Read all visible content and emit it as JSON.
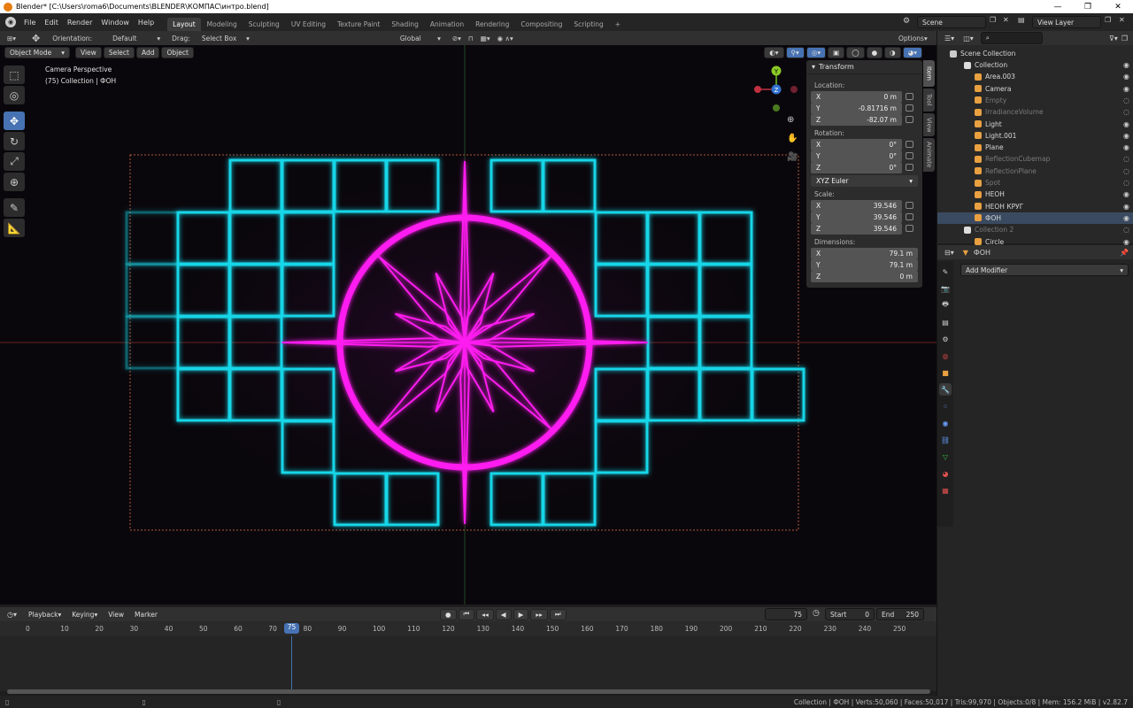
{
  "window": {
    "title": "Blender* [C:\\Users\\roma6\\Documents\\BLENDER\\КОМПАС\\интро.blend]",
    "min": "—",
    "max": "❐",
    "close": "✕"
  },
  "menu": [
    "File",
    "Edit",
    "Render",
    "Window",
    "Help"
  ],
  "workspaces": [
    "Layout",
    "Modeling",
    "Sculpting",
    "UV Editing",
    "Texture Paint",
    "Shading",
    "Animation",
    "Rendering",
    "Compositing",
    "Scripting",
    "+"
  ],
  "scene": {
    "name": "Scene",
    "view_layer": "View Layer"
  },
  "toolheader": {
    "orientation_label": "Orientation:",
    "orientation_value": "Default",
    "drag_label": "Drag:",
    "drag_value": "Select Box",
    "transform_orient": "Global",
    "options": "Options"
  },
  "viewport_header": {
    "mode": "Object Mode",
    "view": "View",
    "select": "Select",
    "add": "Add",
    "object": "Object"
  },
  "viewport": {
    "camera_label": "Camera Perspective",
    "collection_label": "(75) Collection | ФОН",
    "neon_pink": "#ff1cf0",
    "neon_cyan": "#19d6e8",
    "background": "#0a070c"
  },
  "gizmo": {
    "y": "Y",
    "z": "Z"
  },
  "npanel": {
    "title": "Transform",
    "location_label": "Location:",
    "location": [
      {
        "axis": "X",
        "value": "0 m"
      },
      {
        "axis": "Y",
        "value": "-0.81716 m"
      },
      {
        "axis": "Z",
        "value": "-82.07 m"
      }
    ],
    "rotation_label": "Rotation:",
    "rotation": [
      {
        "axis": "X",
        "value": "0°"
      },
      {
        "axis": "Y",
        "value": "0°"
      },
      {
        "axis": "Z",
        "value": "0°"
      }
    ],
    "rotation_mode": "XYZ Euler",
    "scale_label": "Scale:",
    "scale": [
      {
        "axis": "X",
        "value": "39.546"
      },
      {
        "axis": "Y",
        "value": "39.546"
      },
      {
        "axis": "Z",
        "value": "39.546"
      }
    ],
    "dimensions_label": "Dimensions:",
    "dimensions": [
      {
        "axis": "X",
        "value": "79.1 m"
      },
      {
        "axis": "Y",
        "value": "79.1 m"
      },
      {
        "axis": "Z",
        "value": "0 m"
      }
    ],
    "tabs": [
      "Item",
      "Tool",
      "View",
      "Animate"
    ]
  },
  "timeline": {
    "playback": "Playback",
    "keying": "Keying",
    "view": "View",
    "marker": "Marker",
    "current_frame": "75",
    "start_label": "Start",
    "start": "0",
    "end_label": "End",
    "end": "250",
    "ticks": [
      "0",
      "10",
      "20",
      "30",
      "40",
      "50",
      "60",
      "70",
      "80",
      "90",
      "100",
      "110",
      "120",
      "130",
      "140",
      "150",
      "160",
      "170",
      "180",
      "190",
      "200",
      "210",
      "220",
      "230",
      "240",
      "250"
    ]
  },
  "status": "Collection | ФОН | Verts:50,060 | Faces:50,017 | Tris:99,970 | Objects:0/8 | Mem: 156.2 MiB | v2.82.7",
  "outliner": {
    "root": "Scene Collection",
    "items": [
      {
        "name": "Collection",
        "dim": false,
        "icon": "#ddd"
      },
      {
        "name": "Area.003",
        "dim": false,
        "icon": "#e8a040"
      },
      {
        "name": "Camera",
        "dim": false,
        "icon": "#e8a040"
      },
      {
        "name": "Empty",
        "dim": true,
        "icon": "#e8a040"
      },
      {
        "name": "IrradianceVolume",
        "dim": true,
        "icon": "#e8a040"
      },
      {
        "name": "Light",
        "dim": false,
        "icon": "#e8a040"
      },
      {
        "name": "Light.001",
        "dim": false,
        "icon": "#e8a040"
      },
      {
        "name": "Plane",
        "dim": false,
        "icon": "#e8a040"
      },
      {
        "name": "ReflectionCubemap",
        "dim": true,
        "icon": "#e8a040"
      },
      {
        "name": "ReflectionPlane",
        "dim": true,
        "icon": "#e8a040"
      },
      {
        "name": "Spot",
        "dim": true,
        "icon": "#e8a040"
      },
      {
        "name": "НЕОН",
        "dim": false,
        "icon": "#e8a040"
      },
      {
        "name": "НЕОН КРУГ",
        "dim": false,
        "icon": "#e8a040"
      },
      {
        "name": "ФОН",
        "dim": false,
        "icon": "#e8a040"
      },
      {
        "name": "Collection 2",
        "dim": true,
        "icon": "#ddd"
      },
      {
        "name": "Circle",
        "dim": false,
        "icon": "#e8a040"
      }
    ]
  },
  "properties": {
    "object": "ФОН",
    "add_modifier": "Add Modifier"
  }
}
